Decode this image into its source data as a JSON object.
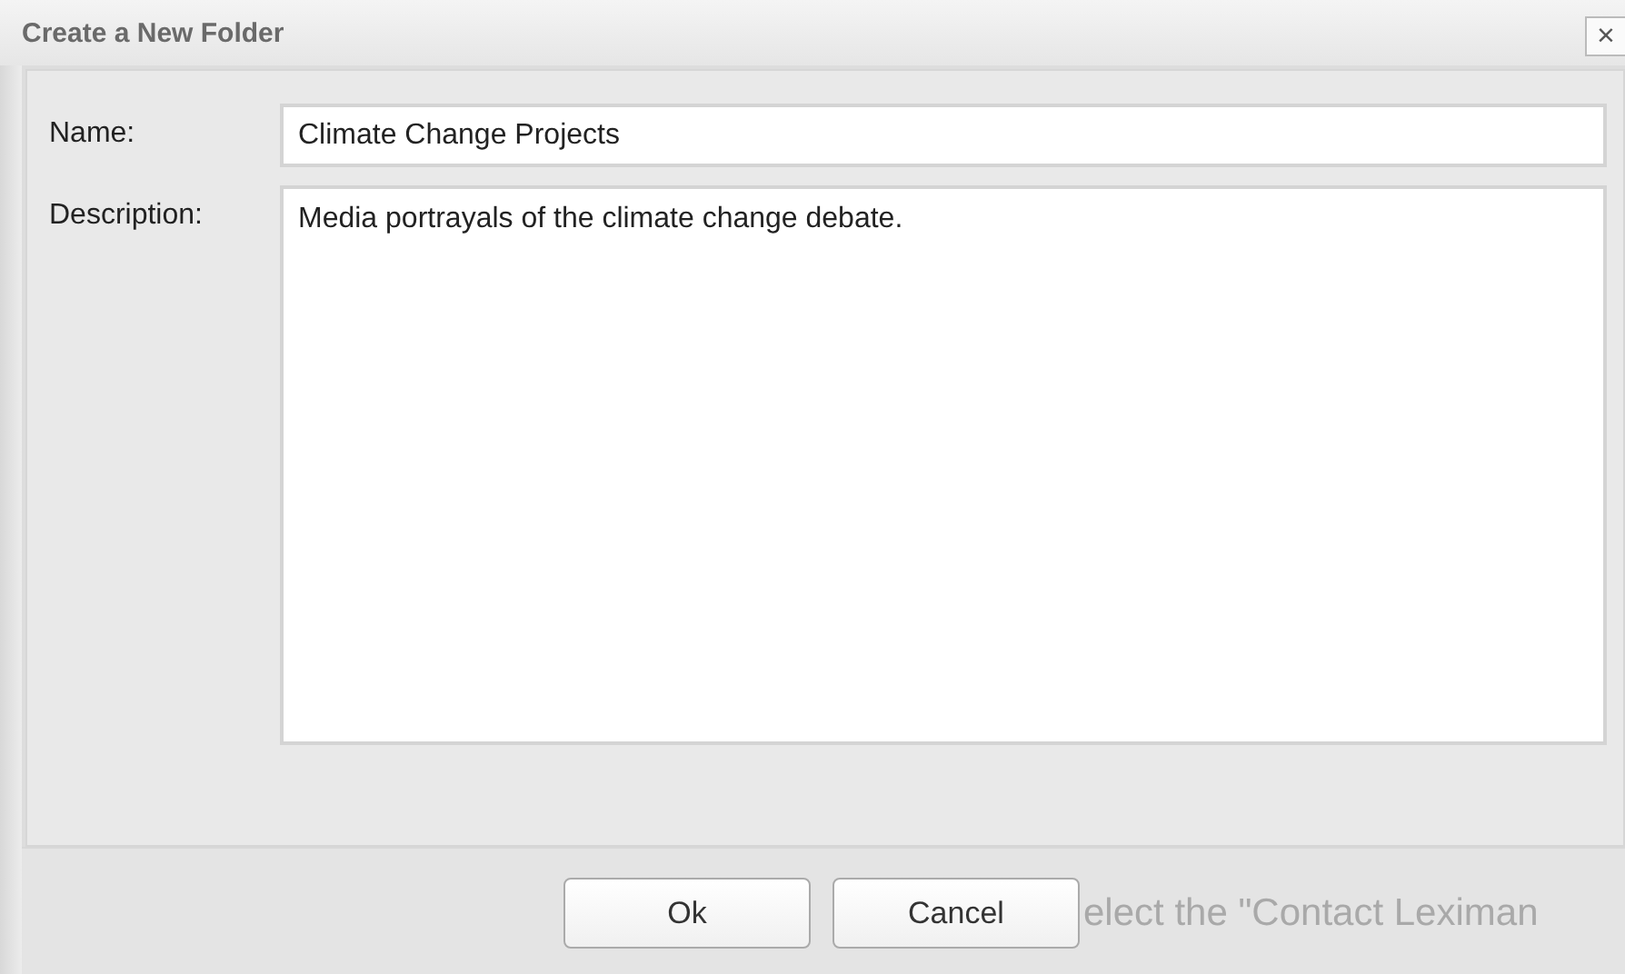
{
  "window": {
    "title": "Create a New Folder",
    "close": "×"
  },
  "fields": [
    {
      "label": "Name:",
      "value": "Climate Change Projects",
      "kind": "text"
    },
    {
      "label": "Description:",
      "value": "Media portrayals of the climate change debate.",
      "kind": "multiline"
    }
  ],
  "buttons": [
    "Ok",
    "Cancel"
  ],
  "background_text": "elect the \"Contact Leximan"
}
